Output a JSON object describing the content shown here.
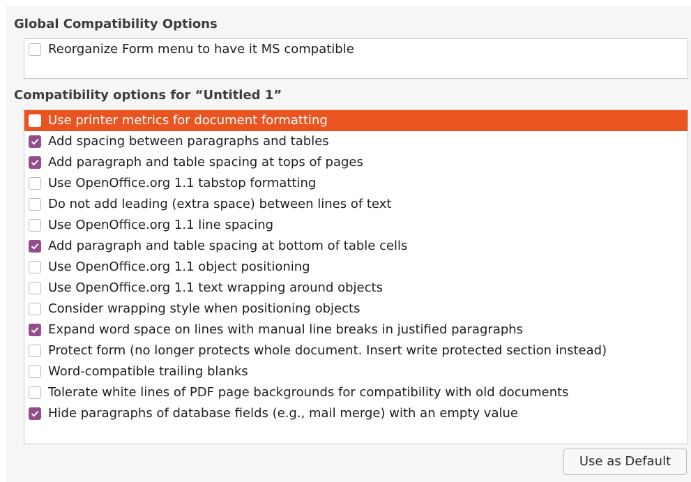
{
  "global": {
    "title": "Global Compatibility Options",
    "items": [
      {
        "label": "Reorganize Form menu to have it MS compatible",
        "checked": false
      }
    ]
  },
  "document": {
    "title": "Compatibility options for “Untitled 1”",
    "selected_index": 0,
    "items": [
      {
        "label": "Use printer metrics for document formatting",
        "checked": false
      },
      {
        "label": "Add spacing between paragraphs and tables",
        "checked": true
      },
      {
        "label": "Add paragraph and table spacing at tops of pages",
        "checked": true
      },
      {
        "label": "Use OpenOffice.org 1.1 tabstop formatting",
        "checked": false
      },
      {
        "label": "Do not add leading (extra space) between lines of text",
        "checked": false
      },
      {
        "label": "Use OpenOffice.org 1.1 line spacing",
        "checked": false
      },
      {
        "label": "Add paragraph and table spacing at bottom of table cells",
        "checked": true
      },
      {
        "label": "Use OpenOffice.org 1.1 object positioning",
        "checked": false
      },
      {
        "label": "Use OpenOffice.org 1.1 text wrapping around objects",
        "checked": false
      },
      {
        "label": "Consider wrapping style when positioning objects",
        "checked": false
      },
      {
        "label": "Expand word space on lines with manual line breaks in justified paragraphs",
        "checked": true
      },
      {
        "label": "Protect form (no longer protects whole document. Insert write protected section instead)",
        "checked": false
      },
      {
        "label": "Word-compatible trailing blanks",
        "checked": false
      },
      {
        "label": "Tolerate white lines of PDF page backgrounds for compatibility with old documents",
        "checked": false
      },
      {
        "label": "Hide paragraphs of database fields (e.g., mail merge) with an empty value",
        "checked": true
      }
    ]
  },
  "actions": {
    "use_as_default": "Use as Default"
  },
  "colors": {
    "accent": "#e95420",
    "checkbox_checked": "#924d8b"
  }
}
